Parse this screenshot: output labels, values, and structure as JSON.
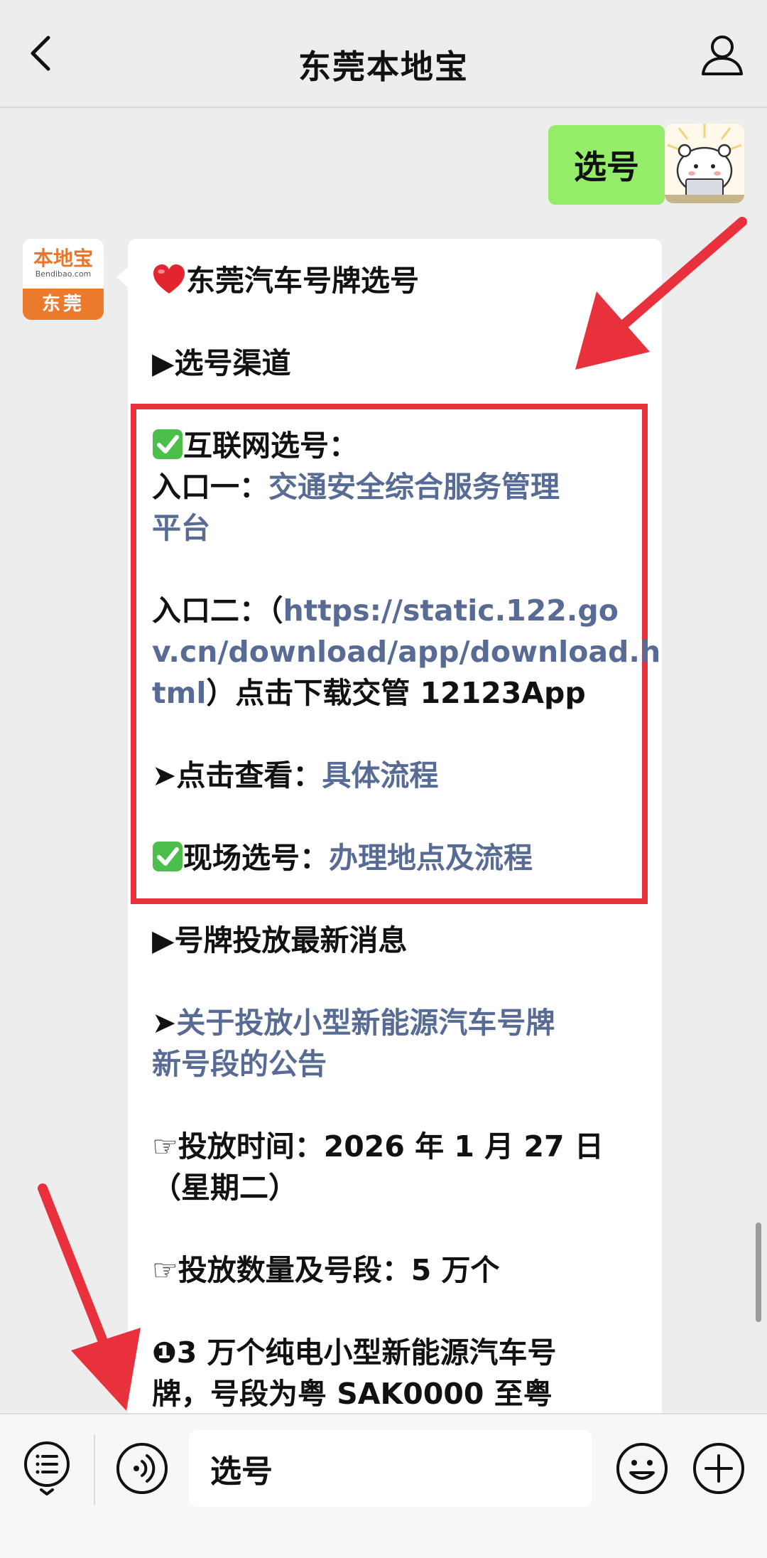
{
  "header": {
    "title": "东莞本地宝"
  },
  "user_message": {
    "text": "选号"
  },
  "bot": {
    "avatar_logo": "本地宝",
    "avatar_site": "Bendibao.com",
    "avatar_city": "东莞"
  },
  "message": {
    "title": "东莞汽车号牌选号",
    "section1": "▶选号渠道",
    "online_label": "互联网选号：",
    "entry1_label": "入口一：",
    "entry1_link_a": "交通安全综合服务管理",
    "entry1_link_b": "平台",
    "entry2_label": "入口二：（",
    "entry2_url_a": "https://static.122.go",
    "entry2_url_b": "v.cn/download/app/download.h",
    "entry2_url_c": "tml",
    "entry2_suffix": "）点击下载交管 12123App",
    "view_label": "➤点击查看：",
    "view_link": "具体流程",
    "onsite_label": "现场选号：",
    "onsite_link": "办理地点及流程",
    "section2": "▶号牌投放最新消息",
    "news_prefix": "➤",
    "news_link_a": "关于投放小型新能源汽车号牌",
    "news_link_b": "新号段的公告",
    "time_a": "☞投放时间：2026 年 1 月 27 日",
    "time_b": "（星期二）",
    "quantity": "☞投放数量及号段：5 万个",
    "item1_a": "❶3 万个纯电小型新能源汽车号",
    "item1_b": "牌，号段为粤 SAK0000 至粤"
  },
  "input": {
    "value": "选号"
  },
  "colors": {
    "user_bubble": "#95ec69",
    "link": "#576b95",
    "highlight": "#e8313d",
    "annotation_arrow": "#e8313d"
  },
  "icons": {
    "back": "chevron-left-icon",
    "profile": "person-icon",
    "menu": "list-menu-icon",
    "voice": "voice-icon",
    "emoji": "emoji-icon",
    "plus": "plus-icon"
  }
}
